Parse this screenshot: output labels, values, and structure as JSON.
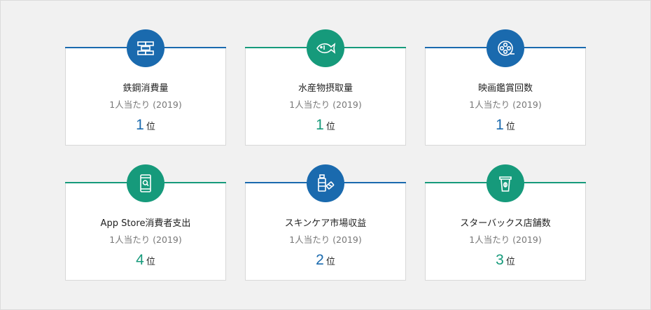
{
  "colors": {
    "blue": "#1a6aae",
    "green": "#169a7b"
  },
  "cards": [
    {
      "icon": "steel-beam-icon",
      "title": "鉄鋼消費量",
      "subtitle": "1人当たり (2019)",
      "rank": "1",
      "unit": "位"
    },
    {
      "icon": "fish-icon",
      "title": "水産物摂取量",
      "subtitle": "1人当たり (2019)",
      "rank": "1",
      "unit": "位"
    },
    {
      "icon": "film-reel-icon",
      "title": "映画鑑賞回数",
      "subtitle": "1人当たり (2019)",
      "rank": "1",
      "unit": "位"
    },
    {
      "icon": "smartphone-search-icon",
      "title": "App Store消費者支出",
      "subtitle": "1人当たり (2019)",
      "rank": "4",
      "unit": "位"
    },
    {
      "icon": "cosmetics-icon",
      "title": "スキンケア市場収益",
      "subtitle": "1人当たり (2019)",
      "rank": "2",
      "unit": "位"
    },
    {
      "icon": "coffee-cup-icon",
      "title": "スターバックス店舗数",
      "subtitle": "1人当たり (2019)",
      "rank": "3",
      "unit": "位"
    }
  ]
}
